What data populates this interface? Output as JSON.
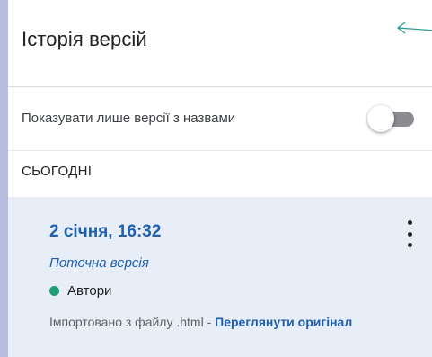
{
  "panel": {
    "title": "Історія версій"
  },
  "filter": {
    "label": "Показувати лише версії з назвами",
    "toggle_on": false
  },
  "section": {
    "label": "СЬОГОДНІ"
  },
  "version": {
    "date": "2 січня, 16:32",
    "status": "Поточна версія",
    "author_label": "Автори",
    "import_text": "Імпортовано з файлу .html - ",
    "view_original_link": "Переглянути оригінал"
  },
  "colors": {
    "accent": "#1f5fad",
    "author_dot": "#1e9e74",
    "item_background": "#e8eef7",
    "page_background": "#b8bde0"
  },
  "icons": {
    "back": "arrow-left-icon",
    "more": "more-vertical-icon"
  }
}
